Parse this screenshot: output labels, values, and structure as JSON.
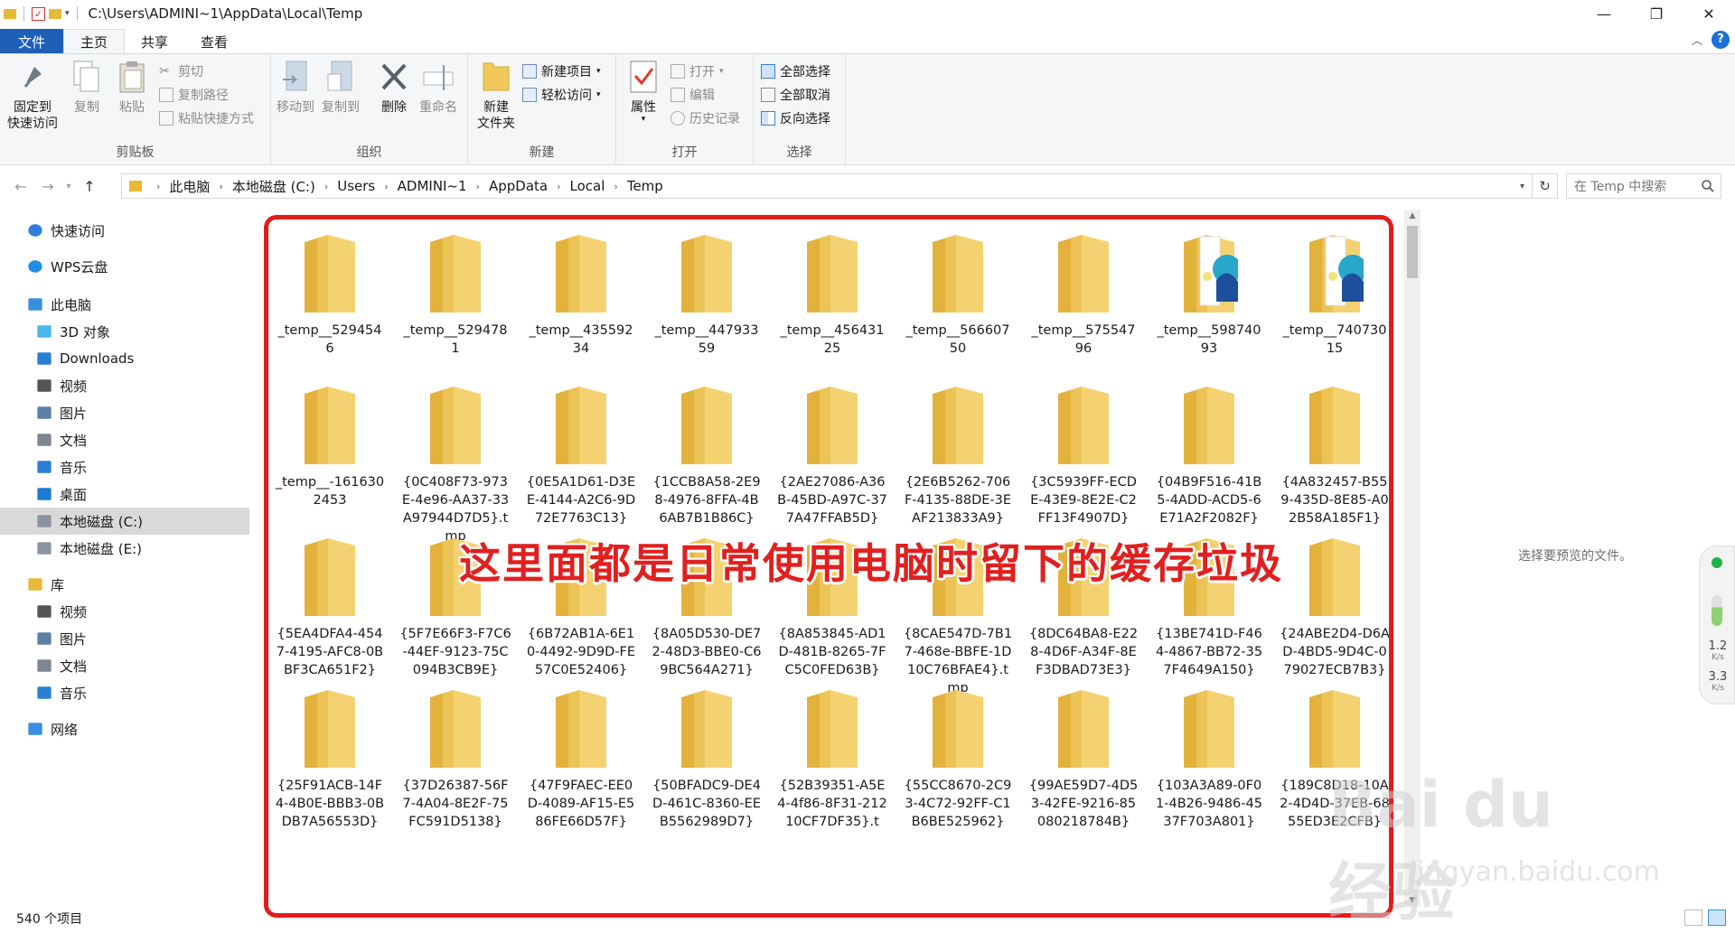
{
  "window": {
    "title": "C:\\Users\\ADMINI~1\\AppData\\Local\\Temp",
    "minimize": "—",
    "maximize": "❐",
    "close": "✕"
  },
  "ribbon_tabs": [
    "文件",
    "主页",
    "共享",
    "查看"
  ],
  "ribbon": {
    "clipboard": {
      "label": "剪贴板",
      "pin_line1": "固定到",
      "pin_line2": "快速访问",
      "copy": "复制",
      "paste": "粘贴",
      "cut": "剪切",
      "copy_path": "复制路径",
      "paste_shortcut": "粘贴快捷方式"
    },
    "organize": {
      "label": "组织",
      "move_to": "移动到",
      "copy_to": "复制到",
      "delete": "删除",
      "rename": "重命名"
    },
    "new": {
      "label": "新建",
      "new_folder_line1": "新建",
      "new_folder_line2": "文件夹",
      "new_item": "新建项目",
      "easy_access": "轻松访问"
    },
    "open": {
      "label": "打开",
      "properties": "属性",
      "open": "打开",
      "edit": "编辑",
      "history": "历史记录"
    },
    "select": {
      "label": "选择",
      "select_all": "全部选择",
      "select_none": "全部取消",
      "invert": "反向选择"
    }
  },
  "address": {
    "crumbs": [
      "此电脑",
      "本地磁盘 (C:)",
      "Users",
      "ADMINI~1",
      "AppData",
      "Local",
      "Temp"
    ],
    "search_placeholder": "在 Temp 中搜索"
  },
  "nav": [
    {
      "label": "快速访问",
      "icon": "star-icon"
    },
    {
      "label": "WPS云盘",
      "icon": "cloud-icon"
    },
    {
      "label": "此电脑",
      "icon": "computer-icon"
    },
    {
      "label": "3D 对象",
      "icon": "cube-icon"
    },
    {
      "label": "Downloads",
      "icon": "download-icon"
    },
    {
      "label": "视频",
      "icon": "video-icon"
    },
    {
      "label": "图片",
      "icon": "picture-icon"
    },
    {
      "label": "文档",
      "icon": "document-icon"
    },
    {
      "label": "音乐",
      "icon": "music-icon"
    },
    {
      "label": "桌面",
      "icon": "desktop-icon"
    },
    {
      "label": "本地磁盘 (C:)",
      "icon": "drive-icon"
    },
    {
      "label": "本地磁盘 (E:)",
      "icon": "drive-icon"
    },
    {
      "label": "库",
      "icon": "library-icon"
    },
    {
      "label": "视频",
      "icon": "video-icon"
    },
    {
      "label": "图片",
      "icon": "picture-icon"
    },
    {
      "label": "文档",
      "icon": "document-icon"
    },
    {
      "label": "音乐",
      "icon": "music-icon"
    },
    {
      "label": "网络",
      "icon": "network-icon"
    }
  ],
  "files": [
    "_temp__5294546",
    "_temp__5294781",
    "_temp__43559234",
    "_temp__44793359",
    "_temp__45643125",
    "_temp__56660750",
    "_temp__57554796",
    "_temp__59874093",
    "_temp__74073015",
    "_temp__-1616302453",
    "{0C408F73-973E-4e96-AA37-33A97944D7D5}.tmp",
    "{0E5A1D61-D3EE-4144-A2C6-9D72E7763C13}",
    "{1CCB8A58-2E98-4976-8FFA-4B6AB7B1B86C}",
    "{2AE27086-A36B-45BD-A97C-377A47FFAB5D}",
    "{2E6B5262-706F-4135-88DE-3EAF213833A9}",
    "{3C5939FF-ECDE-43E9-8E2E-C2FF13F4907D}",
    "{04B9F516-41B5-4ADD-ACD5-6E71A2F2082F}",
    "{4A832457-B559-435D-8E85-A02B58A185F1}",
    "{5EA4DFA4-4547-4195-AFC8-0BBF3CA651F2}",
    "{5F7E66F3-F7C6-44EF-9123-75C094B3CB9E}",
    "{6B72AB1A-6E10-4492-9D9D-FE57C0E52406}",
    "{8A05D530-DE72-48D3-BBE0-C69BC564A271}",
    "{8A853845-AD1D-481B-8265-7FC5C0FED63B}",
    "{8CAE547D-7B17-468e-BBFE-1D10C76BFAE4}.tmp",
    "{8DC64BA8-E228-4D6F-A34F-8EF3DBAD73E3}",
    "{13BE741D-F464-4867-BB72-357F4649A150}",
    "{24ABE2D4-D6AD-4BD5-9D4C-079027ECB7B3}",
    "{25F91ACB-14F4-4B0E-BBB3-0BDB7A56553D}",
    "{37D26387-56F7-4A04-8E2F-75FC591D5138}",
    "{47F9FAEC-EE0D-4089-AF15-E586FE66D57F}",
    "{50BFADC9-DE4D-461C-8360-EEB5562989D7}",
    "{52B39351-A5E4-4f86-8F31-21210CF7DF35}.t",
    "{55CC8670-2C93-4C72-92FF-C1B6BE525962}",
    "{99AE59D7-4D53-42FE-9216-85080218784B}",
    "{103A3A89-0F01-4B26-9486-4537F703A801}",
    "{189C8D18-10A2-4D4D-37EB-6855ED3E2CFB}"
  ],
  "special_icon_indices": [
    7,
    8
  ],
  "overlay_caption": "这里面都是日常使用电脑时留下的缓存垃圾",
  "preview_hint": "选择要预览的文件。",
  "status": {
    "item_count": "540 个项目"
  },
  "netspeed": {
    "up": "1.2",
    "up_unit": "K/s",
    "down": "3.3",
    "down_unit": "K/s"
  },
  "watermark": {
    "brand": "Bai du 经验",
    "url": "jingyan.baidu.com"
  },
  "colors": {
    "accent": "#1e5fb8",
    "folder": "#f1c95a",
    "highlight": "#e41b1b"
  }
}
